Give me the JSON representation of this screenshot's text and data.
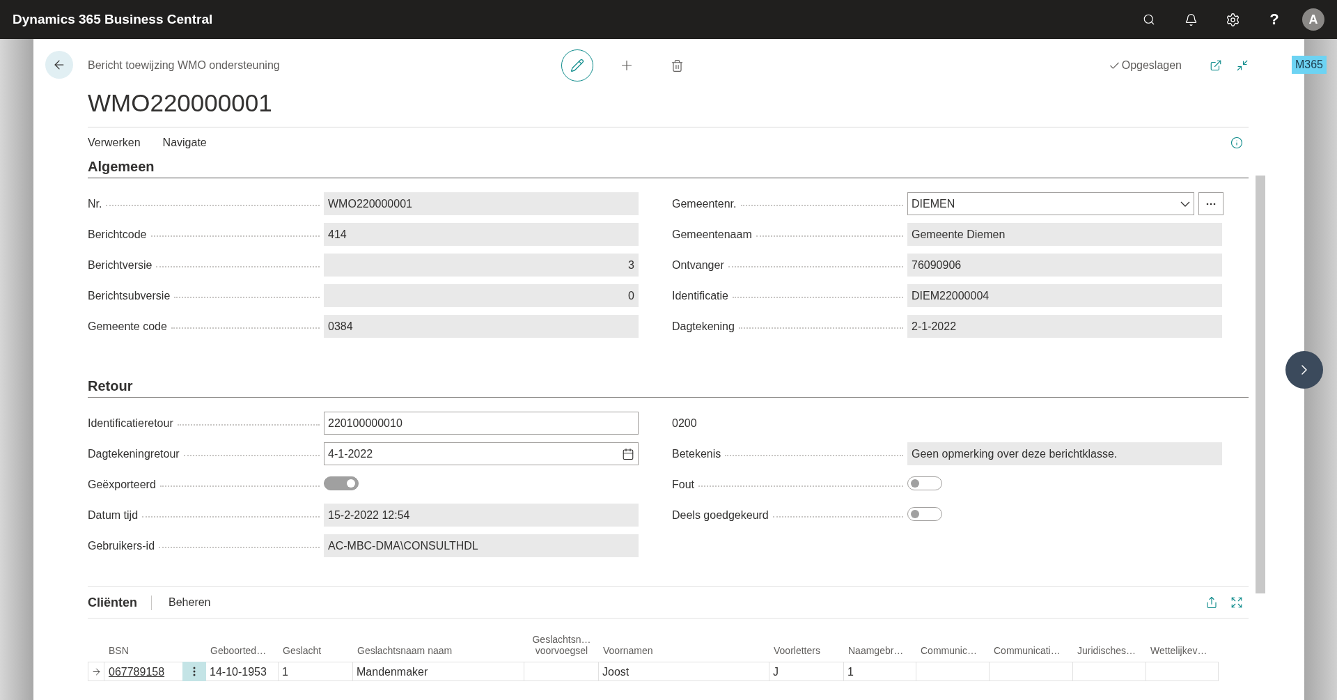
{
  "app_bar": {
    "title": "Dynamics 365 Business Central",
    "help": "?",
    "avatar": "A"
  },
  "badge": "M365",
  "page": {
    "caption": "Bericht toewijzing WMO ondersteuning",
    "title": "WMO220000001",
    "status": "Opgeslagen"
  },
  "actions": [
    {
      "label": "Verwerken"
    },
    {
      "label": "Navigate"
    }
  ],
  "sections": [
    {
      "title": "Algemeen",
      "left": [
        {
          "kind": "text",
          "label": "Nr.",
          "value": "WMO220000001"
        },
        {
          "kind": "text",
          "label": "Berichtcode",
          "value": "414"
        },
        {
          "kind": "number",
          "label": "Berichtversie",
          "value": "3"
        },
        {
          "kind": "number",
          "label": "Berichtsubversie",
          "value": "0"
        },
        {
          "kind": "text",
          "label": "Gemeente code",
          "value": "0384"
        }
      ],
      "right": [
        {
          "kind": "dropdown",
          "label": "Gemeentenr.",
          "value": "DIEMEN"
        },
        {
          "kind": "text",
          "label": "Gemeentenaam",
          "value": "Gemeente Diemen"
        },
        {
          "kind": "text",
          "label": "Ontvanger",
          "value": "76090906"
        },
        {
          "kind": "text",
          "label": "Identificatie",
          "value": "DIEM22000004"
        },
        {
          "kind": "text",
          "label": "Dagtekening",
          "value": "2-1-2022"
        }
      ]
    },
    {
      "title": "Retour",
      "left": [
        {
          "kind": "input",
          "label": "Identificatieretour",
          "value": "220100000010"
        },
        {
          "kind": "date",
          "label": "Dagtekeningretour",
          "value": "4-1-2022"
        },
        {
          "kind": "toggle",
          "label": "Geëxporteerd",
          "on": true
        },
        {
          "kind": "text",
          "label": "Datum tijd",
          "value": "15-2-2022 12:54"
        },
        {
          "kind": "text",
          "label": "Gebruikers-id",
          "value": "AC-MBC-DMA\\CONSULTHDL"
        }
      ],
      "right": [
        {
          "kind": "plain",
          "value": "0200"
        },
        {
          "kind": "text",
          "label": "Betekenis",
          "value": "Geen opmerking over deze berichtklasse."
        },
        {
          "kind": "toggle",
          "label": "Fout",
          "on": false
        },
        {
          "kind": "toggle",
          "label": "Deels goedgekeurd",
          "on": false
        }
      ]
    }
  ],
  "part": {
    "title": "Cliënten",
    "action": "Beheren",
    "columns": [
      "BSN",
      "Geboorted…",
      "Geslacht",
      "Geslachtsnaam naam",
      "Geslachtsn…\nvoorvoegsel",
      "Voornamen",
      "Voorletters",
      "Naamgebr…",
      "Communic…",
      "Communicati…",
      "Juridisches…",
      "Wettelijkev…"
    ],
    "rows": [
      {
        "selected": true,
        "cells": [
          "067789158",
          "14-10-1953",
          "1",
          "Mandenmaker",
          null,
          "Joost",
          "J",
          "1",
          null,
          null,
          null,
          null
        ]
      }
    ]
  }
}
